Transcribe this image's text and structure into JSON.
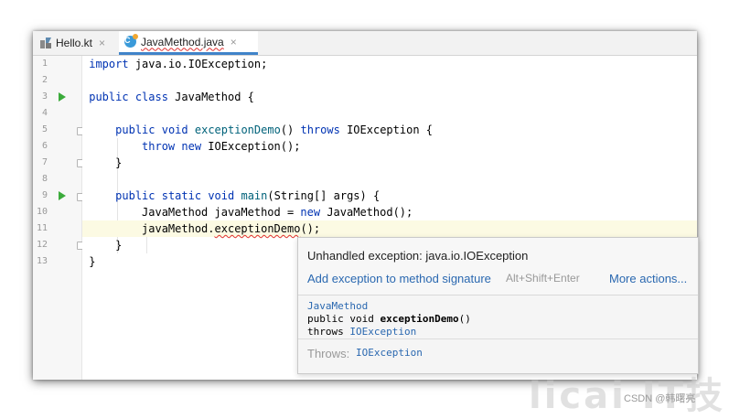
{
  "tabs": [
    {
      "label": "Hello.kt",
      "icon": "kotlin-file-icon",
      "active": false
    },
    {
      "label": "JavaMethod.java",
      "icon": "java-class-icon",
      "active": true
    }
  ],
  "close_glyph": "×",
  "line_numbers": [
    "1",
    "2",
    "3",
    "4",
    "5",
    "6",
    "7",
    "8",
    "9",
    "10",
    "11",
    "12",
    "13"
  ],
  "code": {
    "l1": {
      "kw": "import",
      "rest": " java.io.IOException;"
    },
    "l3": {
      "kw1": "public",
      "kw2": "class",
      "rest": " JavaMethod {"
    },
    "l5": {
      "indent": "    ",
      "kw1": "public",
      "kw2": "void",
      "fn": "exceptionDemo",
      "mid": "() ",
      "kw3": "throws",
      "rest": " IOException {"
    },
    "l6": {
      "indent": "        ",
      "kw1": "throw",
      "kw2": "new",
      "rest": " IOException();"
    },
    "l7": {
      "text": "    }"
    },
    "l9": {
      "indent": "    ",
      "kw1": "public",
      "kw2": "static",
      "kw3": "void",
      "fn": "main",
      "rest": "(String[] args) {"
    },
    "l10": {
      "pre": "        JavaMethod javaMethod = ",
      "kw": "new",
      "rest": " JavaMethod();"
    },
    "l11": {
      "pre": "        javaMethod.",
      "err": "exceptionDemo",
      "rest": "();"
    },
    "l12": {
      "text": "    }"
    },
    "l13": {
      "text": "}"
    }
  },
  "popup": {
    "title": "Unhandled exception: java.io.IOException",
    "action": "Add exception to method signature",
    "shortcut": "Alt+Shift+Enter",
    "more": "More actions...",
    "doc_class": "JavaMethod",
    "doc_sig_pre": "public void ",
    "doc_sig_name": "exceptionDemo",
    "doc_sig_post": "()",
    "doc_throws_kw": "throws ",
    "doc_throws_type": "IOException",
    "throws_label": "Throws:",
    "throws_value": "IOException"
  },
  "watermark": "licai IT技",
  "credit": "CSDN @韩曙亮",
  "colors": {
    "keyword": "#0033b3",
    "function": "#00627a",
    "link": "#2a68b0",
    "run": "#3bab3b",
    "error": "#e03030"
  }
}
